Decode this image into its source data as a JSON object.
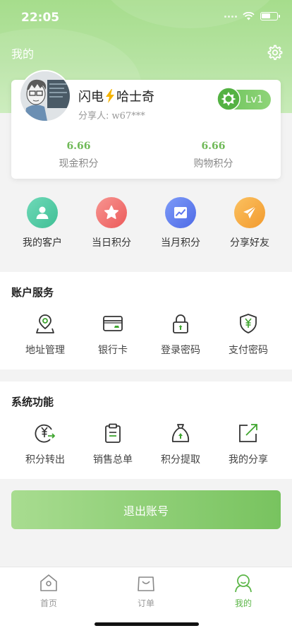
{
  "status": {
    "time": "22:05"
  },
  "header": {
    "title": "我的"
  },
  "profile": {
    "name_part1": "闪电",
    "name_part2": "哈士奇",
    "sharer_label": "分享人:",
    "sharer_value": "w67***",
    "level": "Lv1",
    "scores": [
      {
        "value": "6.66",
        "label": "现金积分"
      },
      {
        "value": "6.66",
        "label": "购物积分"
      }
    ]
  },
  "quick_actions": [
    {
      "label": "我的客户",
      "icon": "customer-icon",
      "color": "#4fc7a3"
    },
    {
      "label": "当日积分",
      "icon": "star-icon",
      "color": "#f2706c"
    },
    {
      "label": "当月积分",
      "icon": "chart-icon",
      "color": "#5b7cf2"
    },
    {
      "label": "分享好友",
      "icon": "send-icon",
      "color": "#f6a53a"
    }
  ],
  "account_services": {
    "title": "账户服务",
    "items": [
      {
        "label": "地址管理",
        "icon": "location-icon"
      },
      {
        "label": "银行卡",
        "icon": "card-icon"
      },
      {
        "label": "登录密码",
        "icon": "lock-icon"
      },
      {
        "label": "支付密码",
        "icon": "shield-yen-icon"
      }
    ]
  },
  "system_functions": {
    "title": "系统功能",
    "items": [
      {
        "label": "积分转出",
        "icon": "transfer-icon"
      },
      {
        "label": "销售总单",
        "icon": "clipboard-icon"
      },
      {
        "label": "积分提取",
        "icon": "moneybag-icon"
      },
      {
        "label": "我的分享",
        "icon": "share-icon"
      }
    ]
  },
  "logout_label": "退出账号",
  "tabbar": [
    {
      "label": "首页",
      "icon": "home-icon",
      "active": false
    },
    {
      "label": "订单",
      "icon": "bag-icon",
      "active": false
    },
    {
      "label": "我的",
      "icon": "user-icon",
      "active": true
    }
  ],
  "colors": {
    "accent": "#5cb648",
    "score": "#6fb957"
  }
}
